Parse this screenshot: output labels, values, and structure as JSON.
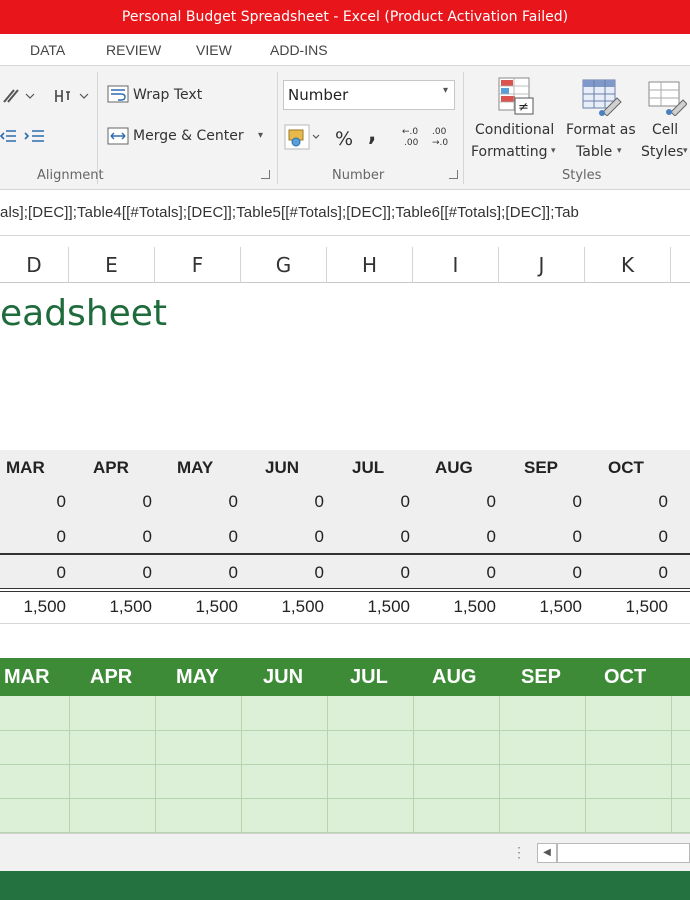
{
  "window": {
    "title": "Personal Budget Spreadsheet -  Excel (Product Activation Failed)"
  },
  "tabs": [
    "DATA",
    "REVIEW",
    "VIEW",
    "ADD-INS"
  ],
  "ribbon": {
    "wrap_text": "Wrap Text",
    "merge_center": "Merge & Center",
    "alignment_label": "Alignment",
    "number_format_value": "Number",
    "percent": "%",
    "comma": ",",
    "number_label": "Number",
    "conditional_formatting": [
      "Conditional",
      "Formatting"
    ],
    "format_as_table": [
      "Format as",
      "Table"
    ],
    "cell_styles": [
      "Cell",
      "Styles"
    ],
    "styles_label": "Styles"
  },
  "formula_bar": {
    "value": "als];[DEC]];Table4[[#Totals];[DEC]];Table5[[#Totals];[DEC]];Table6[[#Totals];[DEC]];Tab"
  },
  "columns": [
    "D",
    "E",
    "F",
    "G",
    "H",
    "I",
    "J",
    "K"
  ],
  "sheet": {
    "title_fragment": "eadsheet",
    "months": [
      "MAR",
      "APR",
      "MAY",
      "JUN",
      "JUL",
      "AUG",
      "SEP",
      "OCT"
    ],
    "summary_rows": [
      [
        "0",
        "0",
        "0",
        "0",
        "0",
        "0",
        "0",
        "0"
      ],
      [
        "0",
        "0",
        "0",
        "0",
        "0",
        "0",
        "0",
        "0"
      ],
      [
        "0",
        "0",
        "0",
        "0",
        "0",
        "0",
        "0",
        "0"
      ],
      [
        "1,500",
        "1,500",
        "1,500",
        "1,500",
        "1,500",
        "1,500",
        "1,500",
        "1,500"
      ]
    ],
    "green_months": [
      "MAR",
      "APR",
      "MAY",
      "JUN",
      "JUL",
      "AUG",
      "SEP",
      "OCT"
    ]
  },
  "colors": {
    "titlebar": "#e8161b",
    "title_text": "#1e6b3b",
    "green_header": "#3d8b37",
    "green_body": "#dcefd7",
    "status_bar": "#23723f"
  }
}
